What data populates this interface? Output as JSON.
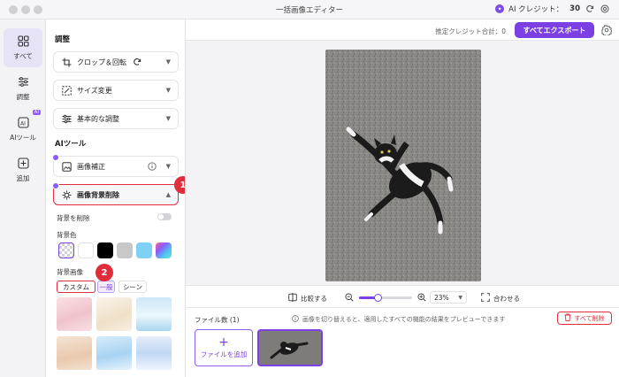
{
  "window": {
    "title": "一括画像エディター"
  },
  "credits": {
    "label": "AI クレジット：",
    "value": "30",
    "badge": "✦"
  },
  "nav": [
    {
      "label": "すべて"
    },
    {
      "label": "調整"
    },
    {
      "label": "AIツール",
      "badge": "AI"
    },
    {
      "label": "追加"
    }
  ],
  "panel": {
    "adjust_title": "調整",
    "adjust_tools": [
      {
        "label": "クロップ＆回転"
      },
      {
        "label": "サイズ変更"
      },
      {
        "label": "基本的な調整"
      }
    ],
    "ai_title": "AIツール",
    "ai_tools": [
      {
        "label": "画像補正"
      },
      {
        "label": "画像背景削除"
      }
    ],
    "remove_bg_label": "背景を削除",
    "bg_color_label": "背景色",
    "bg_colors": [
      "transparent",
      "#ffffff",
      "#000000",
      "#c8c8c8",
      "#7fd0f5",
      "gradient"
    ],
    "bg_image_label": "背景画像",
    "bg_tabs": [
      {
        "label": "カスタム"
      },
      {
        "label": "一般"
      },
      {
        "label": "シーン"
      }
    ],
    "callouts": [
      "1",
      "2"
    ]
  },
  "toolbar": {
    "estimate_label": "推定クレジット合計：",
    "estimate_value": "0",
    "export_label": "すべてエクスポート"
  },
  "zoombar": {
    "compare_label": "比較する",
    "zoom_value": "23%",
    "zoom_fraction": 0.35,
    "fit_label": "合わせる"
  },
  "files": {
    "count_label": "ファイル数 (1)",
    "info_text": "画像を切り替えると、適用したすべての機能の結果をプレビューできます",
    "delete_all_label": "すべて削除",
    "add_label": "ファイルを追加",
    "add_icon": "+"
  },
  "colors": {
    "accent": "#7b3fe4",
    "highlight": "#e02d3c"
  }
}
